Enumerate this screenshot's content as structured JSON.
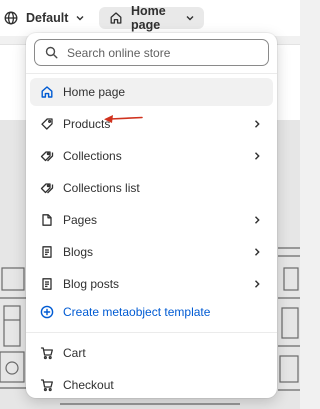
{
  "topbar": {
    "theme_label": "Default",
    "page_label": "Home page"
  },
  "dropdown": {
    "search_placeholder": "Search online store",
    "items": [
      {
        "label": "Home page",
        "icon": "home-icon",
        "selected": true,
        "has_submenu": false
      },
      {
        "label": "Products",
        "icon": "tag-icon",
        "selected": false,
        "has_submenu": true
      },
      {
        "label": "Collections",
        "icon": "collection-icon",
        "selected": false,
        "has_submenu": true
      },
      {
        "label": "Collections list",
        "icon": "collection-list-icon",
        "selected": false,
        "has_submenu": false
      },
      {
        "label": "Pages",
        "icon": "page-icon",
        "selected": false,
        "has_submenu": true
      },
      {
        "label": "Blogs",
        "icon": "blog-icon",
        "selected": false,
        "has_submenu": true
      },
      {
        "label": "Blog posts",
        "icon": "blog-post-icon",
        "selected": false,
        "has_submenu": true
      },
      {
        "label": "Create metaobject template",
        "icon": "plus-circle-icon",
        "selected": false,
        "has_submenu": false
      },
      {
        "label": "Cart",
        "icon": "cart-icon",
        "selected": false,
        "has_submenu": false
      },
      {
        "label": "Checkout",
        "icon": "cart-icon",
        "selected": false,
        "has_submenu": false
      }
    ]
  },
  "colors": {
    "accent_blue": "#005bd3",
    "annotation_arrow": "#d0321e",
    "selected_bg": "#f1f1f1"
  }
}
